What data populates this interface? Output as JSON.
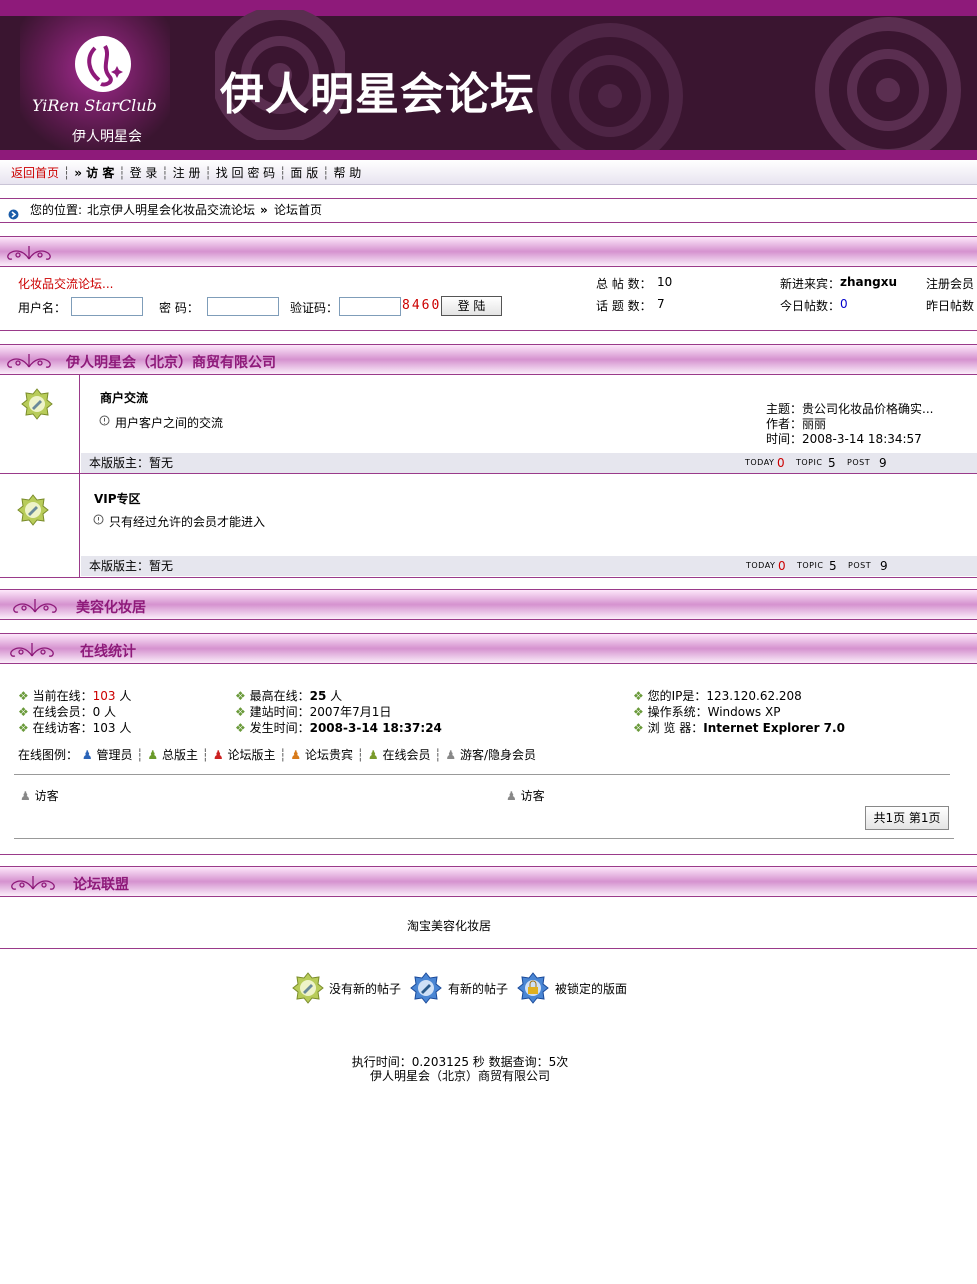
{
  "header": {
    "logo_script": "YiRen StarClub",
    "logo_cn": "伊人明星会",
    "site_title": "伊人明星会论坛"
  },
  "nav": {
    "home": "返回首页",
    "visitor": "» 访 客",
    "login": "登 录",
    "register": "注 册",
    "recover": "找 回 密 码",
    "layout": "面 版",
    "help": "帮 助"
  },
  "breadcrumb": {
    "prefix": "您的位置:",
    "forum": "北京伊人明星会化妆品交流论坛",
    "sep": "»",
    "current": "论坛首页"
  },
  "login_box": {
    "tagline": "化妆品交流论坛...",
    "username_label": "用户名：",
    "password_label": "密 码：",
    "captcha_label": "验证码：",
    "captcha_code": "8460",
    "login_button": "登 陆",
    "total_posts_label": "总 帖 数：",
    "total_posts": "10",
    "topics_label": "话 题 数：",
    "topics": "7",
    "newest_label": "新进来宾：",
    "newest_member": "zhangxu",
    "today_label": "今日帖数：",
    "today_posts": "0",
    "registered_label": "注册会员",
    "yesterday_label": "昨日帖数"
  },
  "category": {
    "title": "伊人明星会（北京）商贸有限公司"
  },
  "boards": [
    {
      "name": "商户交流",
      "desc": "用户客户之间的交流",
      "last_subject": "主题：贵公司化妆品价格确实...",
      "last_author": "作者：丽丽",
      "last_time": "时间：2008-3-14 18:34:57",
      "moderator": "本版版主：暂无",
      "today_label": "TODAY",
      "today": "0",
      "topic_label": "TOPIC",
      "topic": "5",
      "post_label": "POST",
      "post": "9"
    },
    {
      "name": "VIP专区",
      "desc": "只有经过允许的会员才能进入",
      "moderator": "本版版主：暂无",
      "today_label": "TODAY",
      "today": "0",
      "topic_label": "TOPIC",
      "topic": "5",
      "post_label": "POST",
      "post": "9"
    }
  ],
  "beauty_section": {
    "title": "美容化妆居"
  },
  "online": {
    "title": "在线统计",
    "current_label": "当前在线：",
    "current": "103",
    "current_unit": " 人",
    "members_label": "在线会员：",
    "members": "0 人",
    "guests_label": "在线访客：",
    "guests": "103 人",
    "max_label": "最高在线：",
    "max": "25",
    "max_unit": " 人",
    "founded_label": "建站时间：",
    "founded": "2007年7月1日",
    "time_label": "发生时间：",
    "time": "2008-3-14 18:37:24",
    "ip_label": "您的IP是：",
    "ip": "123.120.62.208",
    "os_label": "操作系统：",
    "os": "Windows XP",
    "browser_label": "浏 览 器：",
    "browser": "Internet Explorer 7.0",
    "legend_label": "在线图例：",
    "legend": [
      "管理员",
      "总版主",
      "论坛版主",
      "论坛贵宾",
      "在线会员",
      "游客/隐身会员"
    ],
    "users": [
      "访客",
      "访客"
    ],
    "pager": "共1页 第1页"
  },
  "alliance": {
    "title": "论坛联盟",
    "link": "淘宝美容化妆居"
  },
  "icon_legend": {
    "no_new": "没有新的帖子",
    "has_new": "有新的帖子",
    "locked": "被锁定的版面"
  },
  "footer": {
    "exec": "执行时间：0.203125 秒 数据查询：5次",
    "company": "伊人明星会（北京）商贸有限公司"
  },
  "colors": {
    "brand": "#8e1a7a",
    "banner_bg": "#3a1530",
    "accent_red": "#cc0000"
  }
}
